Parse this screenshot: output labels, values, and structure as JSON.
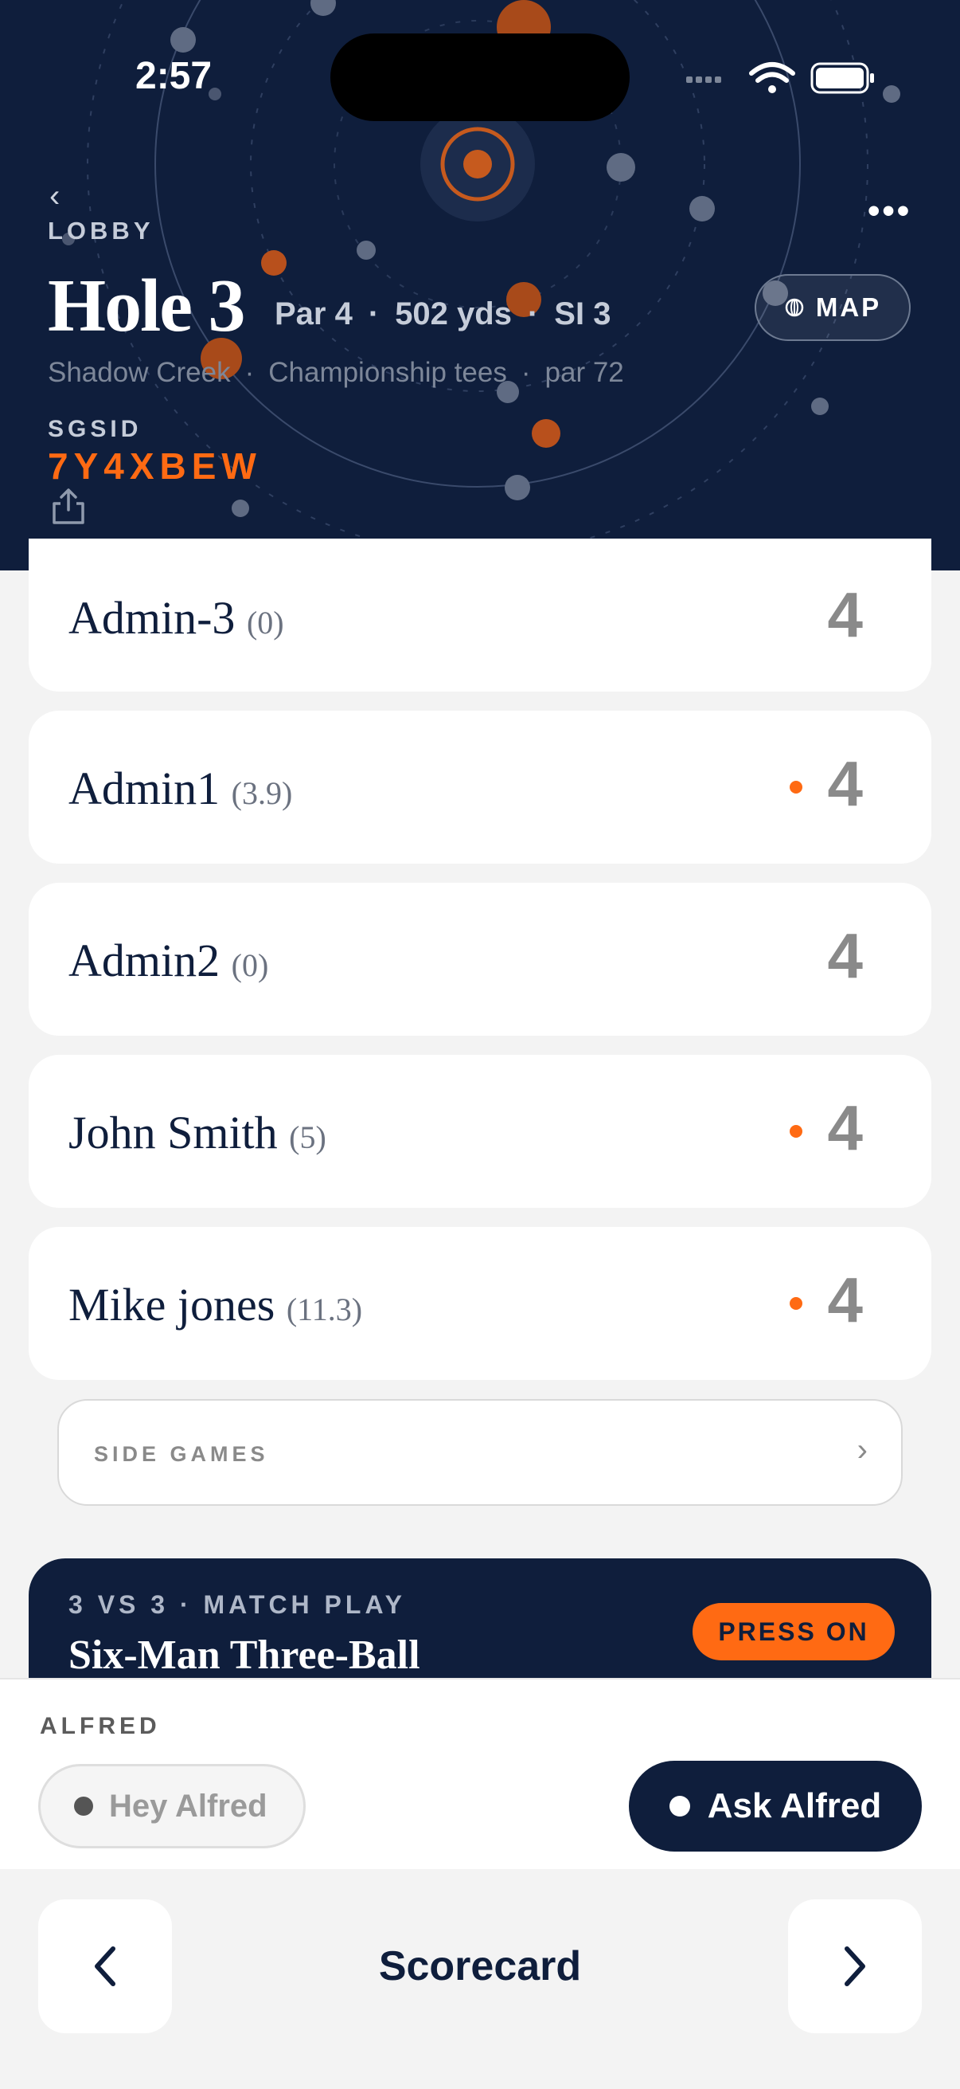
{
  "status_bar": {
    "time": "2:57"
  },
  "header": {
    "back_label": "LOBBY",
    "hole_title": "Hole 3",
    "par": "Par 4",
    "yards": "502 yds",
    "si": "SI 3",
    "map_label": "MAP",
    "course": "Shadow Creek",
    "tees": "Championship tees",
    "course_par": "par 72",
    "sgsid_label": "SGSID",
    "sgsid": "7Y4XBEW"
  },
  "players": [
    {
      "name": "Admin-3",
      "hcp": "(0)",
      "score": "4",
      "marker": false
    },
    {
      "name": "Admin1",
      "hcp": "(3.9)",
      "score": "4",
      "marker": true
    },
    {
      "name": "Admin2",
      "hcp": "(0)",
      "score": "4",
      "marker": false
    },
    {
      "name": "John Smith",
      "hcp": "(5)",
      "score": "4",
      "marker": true
    },
    {
      "name": "Mike jones",
      "hcp": "(11.3)",
      "score": "4",
      "marker": true
    }
  ],
  "side_games": {
    "label": "SIDE GAMES"
  },
  "match": {
    "subtitle": "3 VS 3 · MATCH PLAY",
    "title": "Six-Man Three-Ball",
    "button": "PRESS ON"
  },
  "alfred": {
    "label": "ALFRED",
    "hey": "Hey Alfred",
    "ask": "Ask Alfred"
  },
  "bottom_nav": {
    "title": "Scorecard"
  },
  "colors": {
    "navy": "#0f1e3c",
    "accent": "#ff6a13",
    "background": "#f3f3f3"
  },
  "icons": [
    "back-chevron-icon",
    "more-icon",
    "globe-icon",
    "share-icon",
    "chevron-right-icon",
    "prev-arrow-icon",
    "next-arrow-icon"
  ]
}
